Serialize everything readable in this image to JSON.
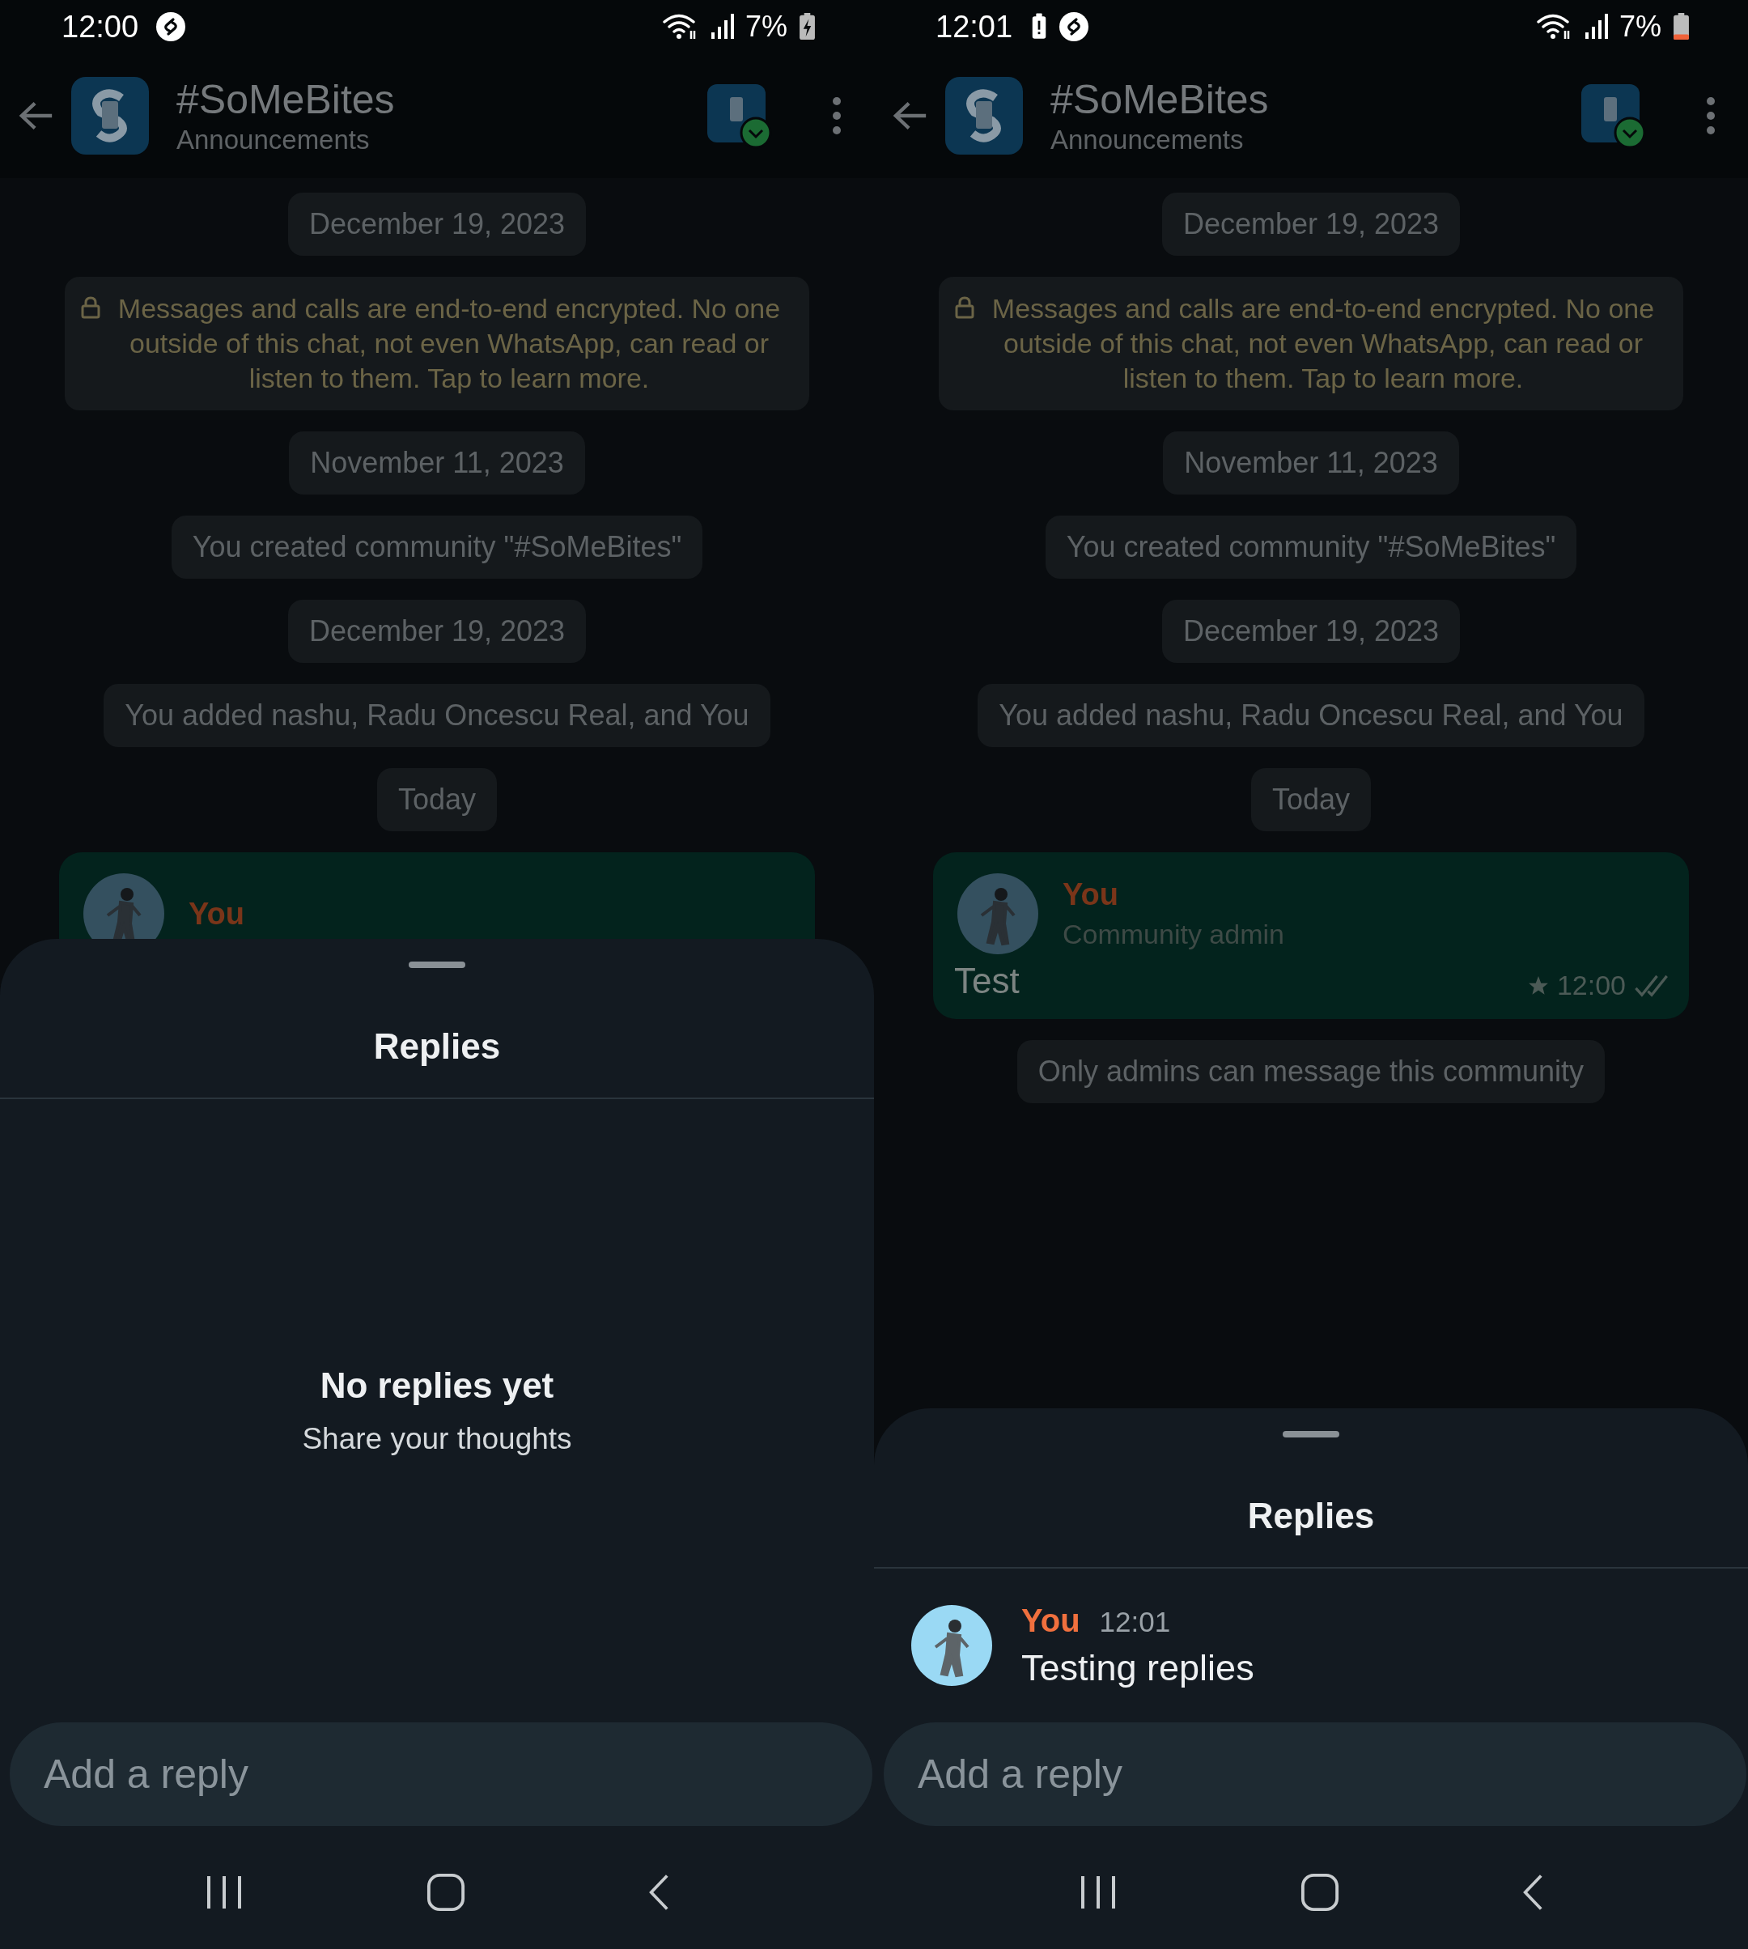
{
  "panels": [
    {
      "status_bar": {
        "time": "12:00",
        "icons": [
          {
            "kind": "swirl"
          }
        ],
        "battery_percent": "7%",
        "charging": true,
        "battery_low": false
      },
      "header": {
        "title": "#SoMeBites",
        "subtitle": "Announcements"
      },
      "chat": [
        {
          "kind": "date",
          "text": "December 19, 2023"
        },
        {
          "kind": "encryption",
          "text": "Messages and calls are end-to-end encrypted. No one outside of this chat, not even WhatsApp, can read or listen to them. Tap to learn more."
        },
        {
          "kind": "date",
          "text": "November 11, 2023"
        },
        {
          "kind": "system",
          "text": "You created community \"#SoMeBites\""
        },
        {
          "kind": "date",
          "text": "December 19, 2023"
        },
        {
          "kind": "system",
          "text": "You added nashu, Radu Oncescu Real, and You"
        },
        {
          "kind": "date",
          "text": "Today"
        },
        {
          "kind": "message",
          "sender": "You"
        }
      ],
      "sheet": {
        "title": "Replies",
        "empty_state": {
          "title": "No replies yet",
          "subtitle": "Share your thoughts"
        },
        "placeholder": "Add a reply"
      }
    },
    {
      "status_bar": {
        "time": "12:01",
        "icons": [
          {
            "kind": "alert"
          },
          {
            "kind": "swirl"
          }
        ],
        "battery_percent": "7%",
        "charging": false,
        "battery_low": true
      },
      "header": {
        "title": "#SoMeBites",
        "subtitle": "Announcements"
      },
      "chat": [
        {
          "kind": "date",
          "text": "December 19, 2023"
        },
        {
          "kind": "encryption",
          "text": "Messages and calls are end-to-end encrypted. No one outside of this chat, not even WhatsApp, can read or listen to them. Tap to learn more."
        },
        {
          "kind": "date",
          "text": "November 11, 2023"
        },
        {
          "kind": "system",
          "text": "You created community \"#SoMeBites\""
        },
        {
          "kind": "date",
          "text": "December 19, 2023"
        },
        {
          "kind": "system",
          "text": "You added nashu, Radu Oncescu Real, and You"
        },
        {
          "kind": "date",
          "text": "Today"
        },
        {
          "kind": "message",
          "sender": "You",
          "role": "Community admin",
          "text": "Test",
          "starred": true,
          "time": "12:00",
          "read": true
        },
        {
          "kind": "system",
          "text": "Only admins can message this community"
        }
      ],
      "sheet": {
        "title": "Replies",
        "replies": [
          {
            "sender": "You",
            "time": "12:01",
            "text": "Testing replies"
          }
        ],
        "placeholder": "Add a reply"
      }
    }
  ]
}
